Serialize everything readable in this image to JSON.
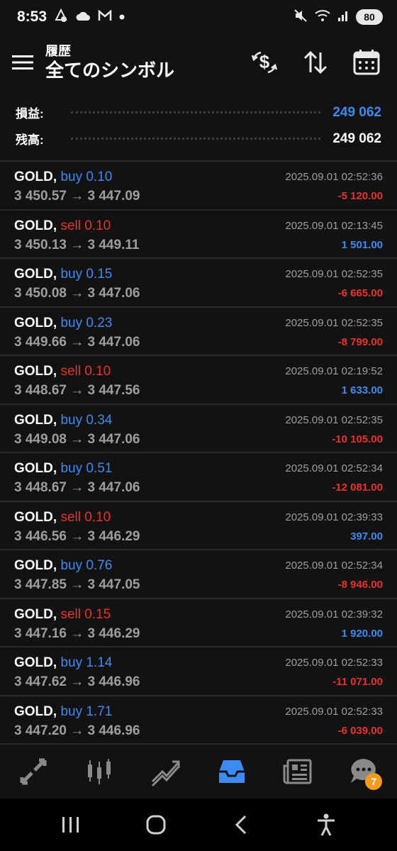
{
  "status_bar": {
    "time": "8:53",
    "icons_left": [
      "notification-app-icon",
      "cloud-icon",
      "gmail-icon",
      "dot-icon"
    ],
    "icons_right": [
      "mute-icon",
      "wifi-icon",
      "signal-icon"
    ],
    "battery": "80"
  },
  "header": {
    "title_small": "履歴",
    "title_large": "全てのシンボル",
    "actions": [
      "dollar-exchange-icon",
      "sort-icon",
      "calendar-icon"
    ]
  },
  "summary": {
    "profit_label": "損益:",
    "profit_value": "249 062",
    "balance_label": "残高:",
    "balance_value": "249 062"
  },
  "trades": [
    {
      "symbol": "GOLD,",
      "side": "buy",
      "side_text": "buy 0.10",
      "prices": "3 450.57 → 3 447.09",
      "time": "2025.09.01 02:52:36",
      "profit": "-5 120.00",
      "sign": "neg"
    },
    {
      "symbol": "GOLD,",
      "side": "sell",
      "side_text": "sell 0.10",
      "prices": "3 450.13 → 3 449.11",
      "time": "2025.09.01 02:13:45",
      "profit": "1 501.00",
      "sign": "pos"
    },
    {
      "symbol": "GOLD,",
      "side": "buy",
      "side_text": "buy 0.15",
      "prices": "3 450.08 → 3 447.06",
      "time": "2025.09.01 02:52:35",
      "profit": "-6 665.00",
      "sign": "neg"
    },
    {
      "symbol": "GOLD,",
      "side": "buy",
      "side_text": "buy 0.23",
      "prices": "3 449.66 → 3 447.06",
      "time": "2025.09.01 02:52:35",
      "profit": "-8 799.00",
      "sign": "neg"
    },
    {
      "symbol": "GOLD,",
      "side": "sell",
      "side_text": "sell 0.10",
      "prices": "3 448.67 → 3 447.56",
      "time": "2025.09.01 02:19:52",
      "profit": "1 633.00",
      "sign": "pos"
    },
    {
      "symbol": "GOLD,",
      "side": "buy",
      "side_text": "buy 0.34",
      "prices": "3 449.08 → 3 447.06",
      "time": "2025.09.01 02:52:35",
      "profit": "-10 105.00",
      "sign": "neg"
    },
    {
      "symbol": "GOLD,",
      "side": "buy",
      "side_text": "buy 0.51",
      "prices": "3 448.67 → 3 447.06",
      "time": "2025.09.01 02:52:34",
      "profit": "-12 081.00",
      "sign": "neg"
    },
    {
      "symbol": "GOLD,",
      "side": "sell",
      "side_text": "sell 0.10",
      "prices": "3 446.56 → 3 446.29",
      "time": "2025.09.01 02:39:33",
      "profit": "397.00",
      "sign": "pos"
    },
    {
      "symbol": "GOLD,",
      "side": "buy",
      "side_text": "buy 0.76",
      "prices": "3 447.85 → 3 447.05",
      "time": "2025.09.01 02:52:34",
      "profit": "-8 946.00",
      "sign": "neg"
    },
    {
      "symbol": "GOLD,",
      "side": "sell",
      "side_text": "sell 0.15",
      "prices": "3 447.16 → 3 446.29",
      "time": "2025.09.01 02:39:32",
      "profit": "1 920.00",
      "sign": "pos"
    },
    {
      "symbol": "GOLD,",
      "side": "buy",
      "side_text": "buy 1.14",
      "prices": "3 447.62 → 3 446.96",
      "time": "2025.09.01 02:52:33",
      "profit": "-11 071.00",
      "sign": "neg"
    },
    {
      "symbol": "GOLD,",
      "side": "buy",
      "side_text": "buy 1.71",
      "prices": "3 447.20 → 3 446.96",
      "time": "2025.09.01 02:52:33",
      "profit": "-6 039.00",
      "sign": "neg"
    }
  ],
  "bottom_nav": {
    "items": [
      "quotes-icon",
      "chart-icon",
      "trade-icon",
      "history-icon",
      "news-icon",
      "chat-icon"
    ],
    "active": "history-icon",
    "chat_badge": "7"
  },
  "colors": {
    "background": "#121212",
    "buy": "#3d8bf2",
    "sell": "#e8332c",
    "muted": "#9e9e9e",
    "badge": "#f39a1c"
  }
}
